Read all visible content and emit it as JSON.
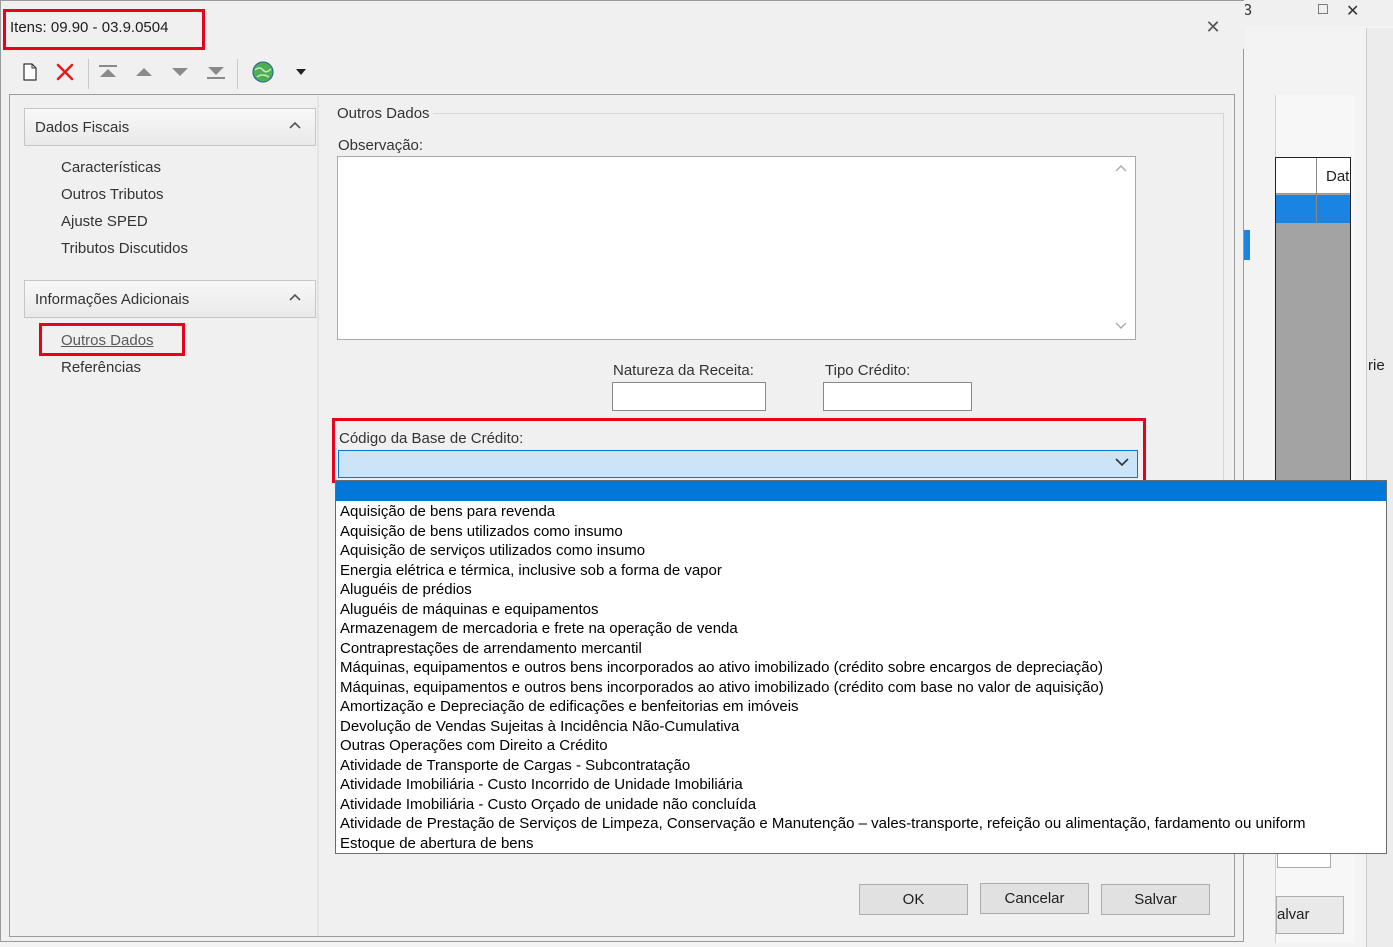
{
  "dialog": {
    "title": "Itens: 09.90 - 03.9.0504",
    "close_glyph": "✕"
  },
  "toolbar": {
    "icons": [
      "new-document-icon",
      "delete-icon",
      "first-record-icon",
      "previous-record-icon",
      "next-record-icon",
      "last-record-icon",
      "globe-icon",
      "dropdown-arrow-icon"
    ]
  },
  "nav": {
    "sections": [
      {
        "label": "Dados Fiscais",
        "items": [
          "Características",
          "Outros Tributos",
          "Ajuste SPED",
          "Tributos Discutidos"
        ]
      },
      {
        "label": "Informações Adicionais",
        "items": [
          "Outros Dados",
          "Referências"
        ]
      }
    ],
    "active_item": "Outros Dados"
  },
  "panel": {
    "group_title": "Outros Dados",
    "observacao_label": "Observação:",
    "observacao_value": "",
    "natureza_label": "Natureza da Receita:",
    "natureza_value": "",
    "tipo_credito_label": "Tipo Crédito:",
    "tipo_credito_value": "",
    "codigo_base_label": "Código da Base de Crédito:",
    "codigo_base_value": ""
  },
  "dropdown": {
    "options": [
      "Aquisição de bens para revenda",
      "Aquisição de bens utilizados como insumo",
      "Aquisição de serviços utilizados como insumo",
      "Energia elétrica e térmica, inclusive sob a forma de vapor",
      "Aluguéis de prédios",
      "Aluguéis de máquinas e equipamentos",
      "Armazenagem de mercadoria e frete na operação de venda",
      "Contraprestações de arrendamento mercantil",
      "Máquinas, equipamentos e outros bens incorporados ao ativo imobilizado (crédito sobre encargos de depreciação)",
      "Máquinas, equipamentos e outros bens incorporados ao ativo imobilizado (crédito com base no valor de aquisição)",
      "Amortização e Depreciação de edificações e benfeitorias em imóveis",
      "Devolução de Vendas Sujeitas à Incidência Não-Cumulativa",
      "Outras Operações com Direito a Crédito",
      "Atividade de Transporte de Cargas - Subcontratação",
      "Atividade Imobiliária - Custo Incorrido de Unidade Imobiliária",
      "Atividade Imobiliária - Custo Orçado de unidade não concluída",
      "Atividade de Prestação de Serviços de Limpeza, Conservação e Manutenção – vales-transporte, refeição ou alimentação, fardamento ou uniform",
      "Estoque de abertura de bens"
    ]
  },
  "buttons": {
    "ok": "OK",
    "cancel": "Cancelar",
    "save": "Salvar"
  },
  "background": {
    "grid_header": "Dat",
    "serie_label": "rie",
    "salvar_fragment": "alvar",
    "title_fragment": "3",
    "maximize_glyph": "□",
    "close_glyph": "✕"
  },
  "colors": {
    "highlight": "#e8001c",
    "selection": "#0078d7",
    "combo_focus": "#cce4f7"
  }
}
